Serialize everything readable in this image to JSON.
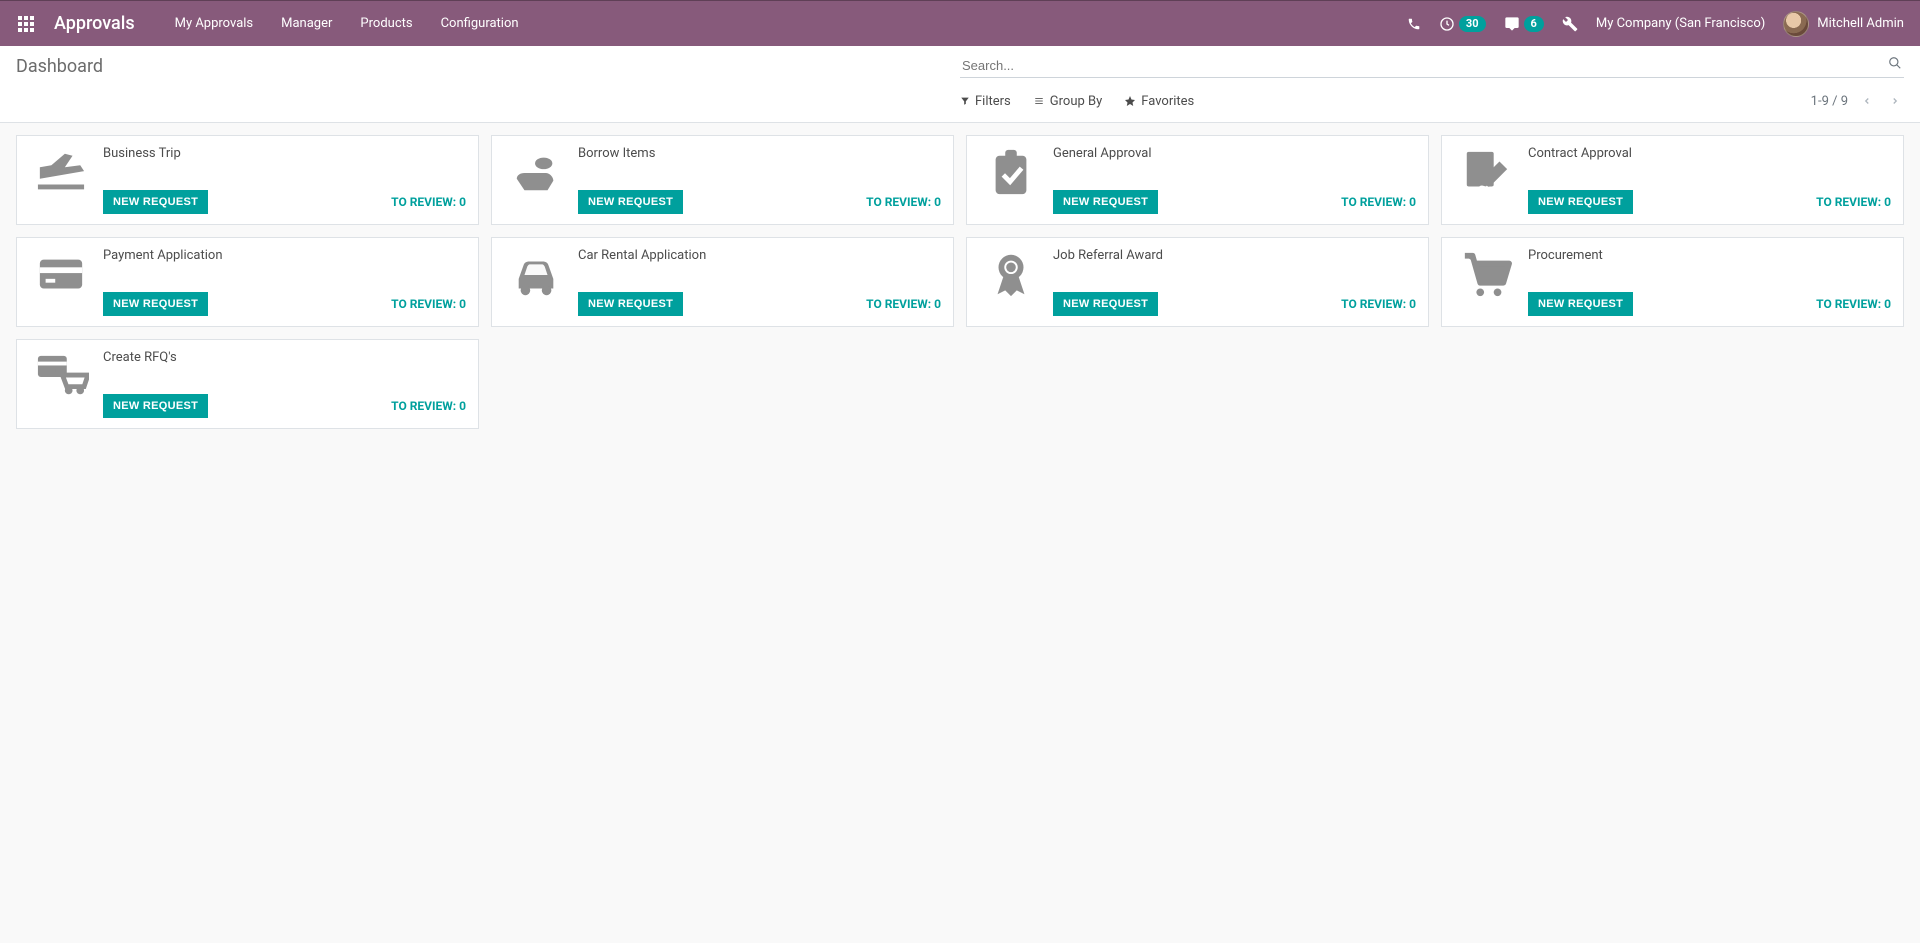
{
  "navbar": {
    "brand": "Approvals",
    "links": [
      "My Approvals",
      "Manager",
      "Products",
      "Configuration"
    ],
    "clock_badge": "30",
    "chat_badge": "6",
    "company": "My Company (San Francisco)",
    "user": "Mitchell Admin"
  },
  "control_panel": {
    "breadcrumb": "Dashboard",
    "search_placeholder": "Search...",
    "filters_label": "Filters",
    "groupby_label": "Group By",
    "favorites_label": "Favorites",
    "pager": "1-9 / 9"
  },
  "buttons": {
    "new_request": "NEW REQUEST",
    "to_review_prefix": "TO REVIEW: "
  },
  "cards": [
    {
      "title": "Business Trip",
      "icon": "plane",
      "to_review": 0
    },
    {
      "title": "Borrow Items",
      "icon": "hand",
      "to_review": 0
    },
    {
      "title": "General Approval",
      "icon": "clipboard",
      "to_review": 0
    },
    {
      "title": "Contract Approval",
      "icon": "sign",
      "to_review": 0
    },
    {
      "title": "Payment Application",
      "icon": "card",
      "to_review": 0
    },
    {
      "title": "Car Rental Application",
      "icon": "car",
      "to_review": 0
    },
    {
      "title": "Job Referral Award",
      "icon": "award",
      "to_review": 0
    },
    {
      "title": "Procurement",
      "icon": "cart",
      "to_review": 0
    },
    {
      "title": "Create RFQ's",
      "icon": "rfq",
      "to_review": 0
    }
  ]
}
